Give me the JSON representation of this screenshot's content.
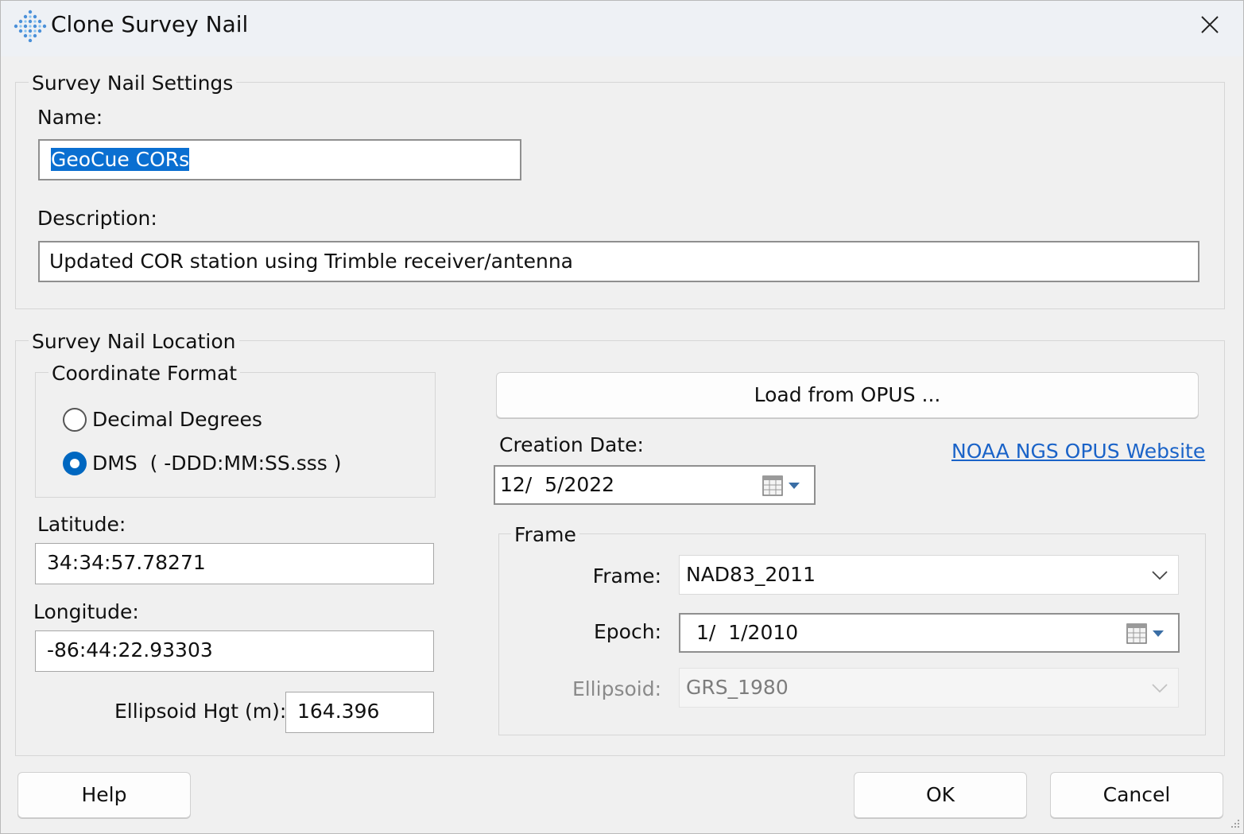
{
  "window": {
    "title": "Clone Survey Nail",
    "icon": "diamond-grid-app-icon"
  },
  "settings_group": {
    "legend": "Survey Nail Settings",
    "name_label": "Name:",
    "name_value": "GeoCue CORs",
    "description_label": "Description:",
    "description_value": "Updated COR station using Trimble receiver/antenna"
  },
  "location_group": {
    "legend": "Survey Nail Location",
    "coordinate_format": {
      "legend": "Coordinate Format",
      "options": [
        {
          "label": "Decimal Degrees",
          "selected": false
        },
        {
          "label": "DMS  ( -DDD:MM:SS.sss )",
          "selected": true
        }
      ]
    },
    "latitude_label": "Latitude:",
    "latitude_value": "34:34:57.78271",
    "longitude_label": "Longitude:",
    "longitude_value": "-86:44:22.93303",
    "ellipsoid_hgt_label": "Ellipsoid Hgt (m):",
    "ellipsoid_hgt_value": "164.396",
    "load_opus_button": "Load from OPUS ...",
    "creation_date_label": "Creation Date:",
    "creation_date_value": "12/  5/2022",
    "opus_link": "NOAA NGS OPUS Website",
    "frame_group": {
      "legend": "Frame",
      "frame_label": "Frame:",
      "frame_value": "NAD83_2011",
      "epoch_label": "Epoch:",
      "epoch_value": "1/  1/2010",
      "ellipsoid_label": "Ellipsoid:",
      "ellipsoid_value": "GRS_1980"
    }
  },
  "buttons": {
    "help": "Help",
    "ok": "OK",
    "cancel": "Cancel"
  },
  "colors": {
    "accent": "#0067c0",
    "selection": "#0a6fd1",
    "link": "#1a63c8"
  }
}
